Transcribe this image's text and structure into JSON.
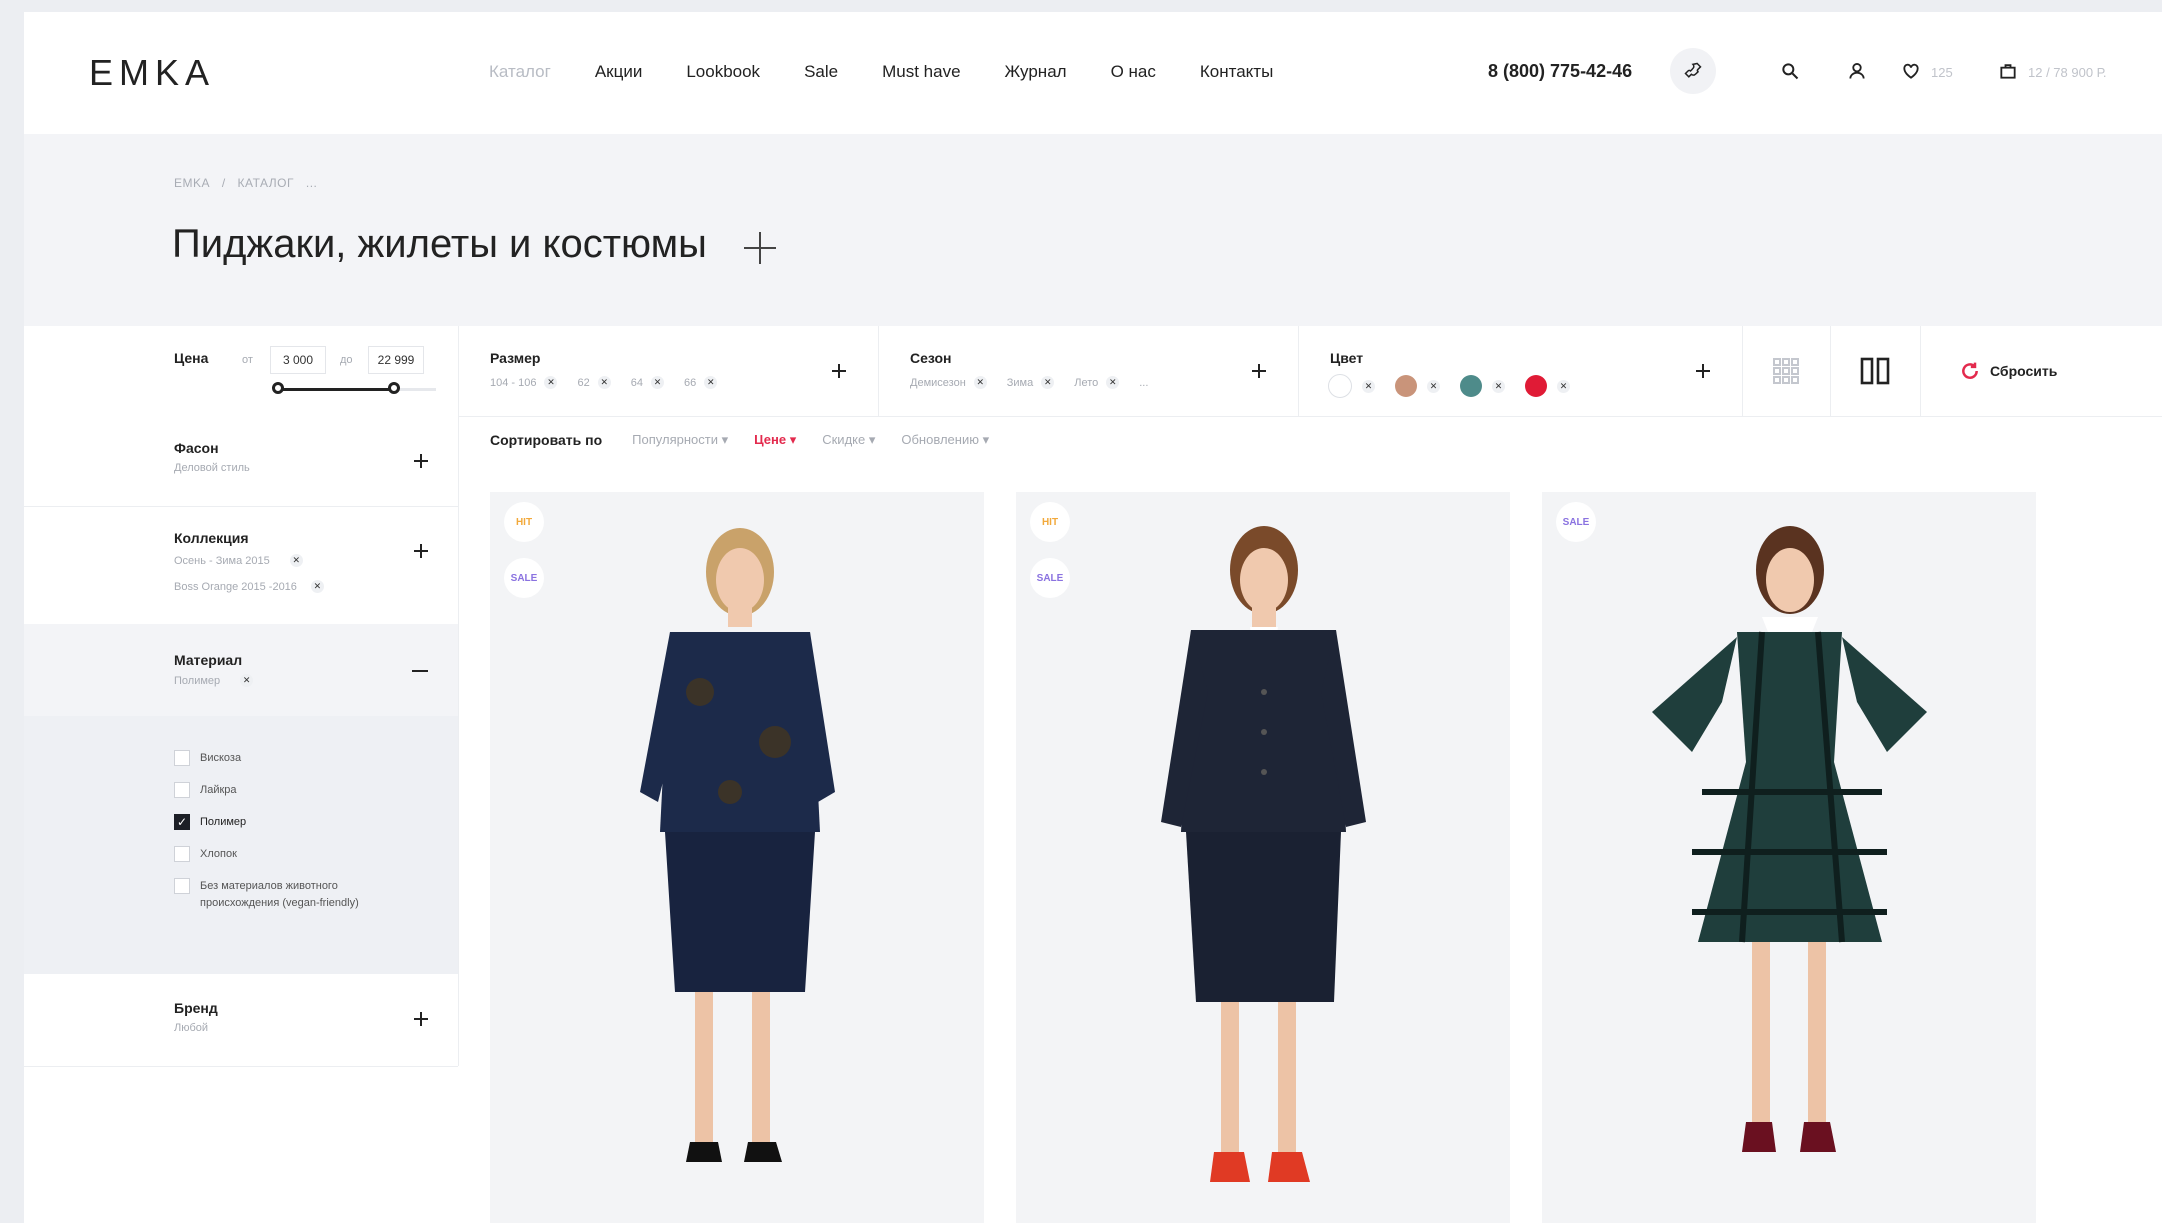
{
  "header": {
    "logo": "EMKA",
    "nav": [
      "Каталог",
      "Акции",
      "Lookbook",
      "Sale",
      "Must have",
      "Журнал",
      "О нас",
      "Контакты"
    ],
    "phone": "8 (800) 775-42-46",
    "favorites_count": "125",
    "cart_summary": "12 / 78 900 Р."
  },
  "breadcrumbs": [
    "EMKA",
    "/",
    "КАТАЛОГ",
    "..."
  ],
  "page_title": "Пиджаки, жилеты и костюмы",
  "filters": {
    "price": {
      "label": "Цена",
      "from_label": "от",
      "from": "3 000",
      "to_label": "до",
      "to": "22 999"
    },
    "size": {
      "label": "Размер",
      "values": [
        "104 - 106",
        "62",
        "64",
        "66"
      ]
    },
    "season": {
      "label": "Сезон",
      "values": [
        "Демисезон",
        "Зима",
        "Лето",
        "..."
      ]
    },
    "color": {
      "label": "Цвет",
      "swatches": [
        "#ffffff",
        "#c9947a",
        "#4e8b8a",
        "#e01b36"
      ]
    },
    "reset": "Сбросить"
  },
  "sidebar": {
    "style": {
      "title": "Фасон",
      "value": "Деловой стиль"
    },
    "collection": {
      "title": "Коллекция",
      "values": [
        "Осень - Зима 2015",
        "Boss Orange 2015 -2016"
      ]
    },
    "material": {
      "title": "Материал",
      "value": "Полимер",
      "options": [
        {
          "label": "Вискоза",
          "checked": false
        },
        {
          "label": "Лайкра",
          "checked": false
        },
        {
          "label": "Полимер",
          "checked": true
        },
        {
          "label": "Хлопок",
          "checked": false
        },
        {
          "label": "Без материалов животного происхождения (vegan-friendly)",
          "checked": false
        }
      ]
    },
    "brand": {
      "title": "Бренд",
      "value": "Любой"
    }
  },
  "sort": {
    "label": "Сортировать по",
    "options": [
      "Популярности",
      "Цене",
      "Скидке",
      "Обновлению"
    ],
    "active": "Цене"
  },
  "products": [
    {
      "badges": [
        "HIT",
        "SALE"
      ]
    },
    {
      "badges": [
        "HIT",
        "SALE"
      ]
    },
    {
      "badges": [
        "SALE"
      ]
    }
  ]
}
